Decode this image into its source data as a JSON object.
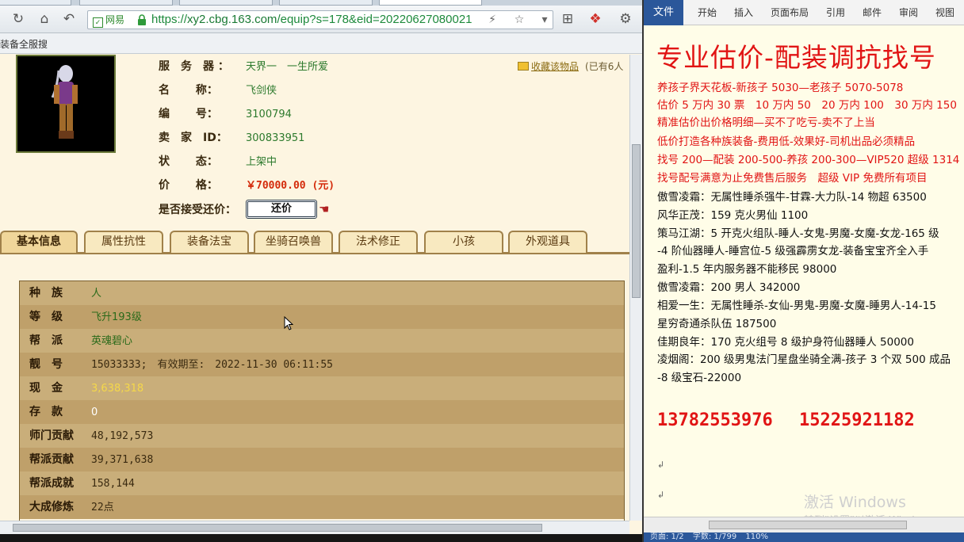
{
  "browser": {
    "url": {
      "prefix": "https://",
      "host": "xy2.cbg.163.com",
      "path": "/equip?s=178&eid=20220627080021"
    },
    "site_label": "网易",
    "bookmark": "装备全服搜"
  },
  "summary": {
    "server": {
      "label": "服　务　器 ：",
      "value": "天界一　一生所爱"
    },
    "name": {
      "label": "名　　 称：",
      "value": "飞剑侠"
    },
    "number": {
      "label": "编　　 号：",
      "value": "3100794"
    },
    "seller": {
      "label": "卖　家　ID：",
      "value": "300833951"
    },
    "status": {
      "label": "状　　 态：",
      "value": "上架中"
    },
    "price": {
      "label": "价　　 格：",
      "value": "￥70000.00 (元)"
    },
    "bargain": {
      "label": "是否接受还价：",
      "button": "还价"
    },
    "favorite": {
      "link": "收藏该物品",
      "count": "(已有6人"
    }
  },
  "tabs": [
    "基本信息",
    "属性抗性",
    "装备法宝",
    "坐骑召唤兽",
    "法术修正",
    "小孩",
    "外观道具"
  ],
  "info_rows": [
    {
      "label": "种　族",
      "value": "人",
      "style": "green"
    },
    {
      "label": "等　级",
      "value": "飞升193级",
      "style": "green"
    },
    {
      "label": "帮　派",
      "value": "英魂碧心",
      "style": "green"
    },
    {
      "label": "靓　号",
      "value": "15033333;　有效期至:　2022-11-30 06:11:55",
      "style": "dark"
    },
    {
      "label": "现　金",
      "value": "3,638,318",
      "style": "gold"
    },
    {
      "label": "存　款",
      "value": "0",
      "style": "white"
    },
    {
      "label": "师门贡献",
      "value": "48,192,573",
      "style": "dark"
    },
    {
      "label": "帮派贡献",
      "value": "39,371,638",
      "style": "dark"
    },
    {
      "label": "帮派成就",
      "value": "158,144",
      "style": "dark"
    },
    {
      "label": "大成修炼",
      "value": "22点",
      "style": "dark"
    }
  ],
  "word": {
    "file_tab": "文件",
    "ribbon_tabs": [
      "开始",
      "插入",
      "页面布局",
      "引用",
      "邮件",
      "审阅",
      "视图"
    ],
    "title": "专业估价-配装调抗找号",
    "lines": [
      {
        "text": "养孩子界天花板-新孩子 5030—老孩子 5070-5078",
        "color": "red"
      },
      {
        "text": "估价 5 万内 30 票　10 万内 50　20 万内 100　30 万内 150",
        "color": "red"
      },
      {
        "text": "精准估价出价格明细—买不了吃亏-卖不了上当",
        "color": "red"
      },
      {
        "text": "低价打造各种族装备-费用低-效果好-司机出品必须精品",
        "color": "red"
      },
      {
        "text": "找号 200—配装 200-500-养孩 200-300—VIP520 超级 1314",
        "color": "red"
      },
      {
        "text": "找号配号满意为止免费售后服务　超级 VIP 免费所有项目",
        "color": "red"
      },
      {
        "text": "傲雪凌霜：无属性睡杀强牛-甘霖-大力队-14 物超 63500",
        "color": "black"
      },
      {
        "text": "风华正茂：159 克火男仙 1100",
        "color": "black"
      },
      {
        "text": "策马江湖：5 开克火组队-睡人-女鬼-男魔-女魔-女龙-165 级",
        "color": "black"
      },
      {
        "text": "-4 阶仙器睡人-睡宫位-5 级强霹雳女龙-装备宝宝齐全入手",
        "color": "black"
      },
      {
        "text": "盈利-1.5 年内服务器不能移民 98000",
        "color": "black"
      },
      {
        "text": "傲雪凌霜：200 男人 342000",
        "color": "black"
      },
      {
        "text": "相爱一生：无属性睡杀-女仙-男鬼-男魔-女魔-睡男人-14-15",
        "color": "black"
      },
      {
        "text": "星穷奇通杀队伍 187500",
        "color": "black"
      },
      {
        "text": "佳期良年：170 克火组号 8 级护身符仙器睡人 50000",
        "color": "black"
      },
      {
        "text": "凌烟阁：200 级男鬼法门星盘坐骑全满-孩子 3 个双 500 成品",
        "color": "black"
      },
      {
        "text": "-8 级宝石-22000",
        "color": "black"
      }
    ],
    "phones": [
      "13782553976",
      "15225921182"
    ],
    "watermark_title": "激活 Windows",
    "watermark_sub": "转到\"设置\"以激活 Windows。",
    "status": [
      "页面: 1/2",
      "字数: 1/799",
      "110%"
    ]
  }
}
